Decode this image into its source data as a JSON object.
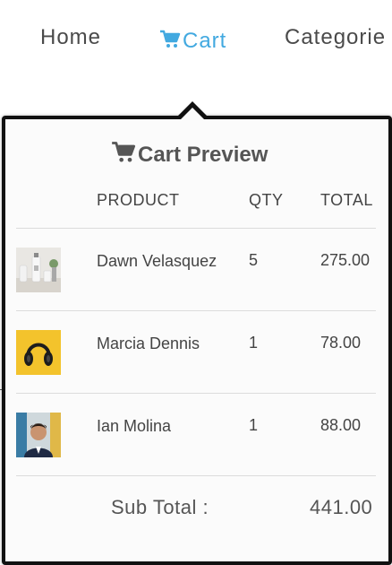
{
  "nav": {
    "home_label": "Home",
    "cart_label": "Cart",
    "categories_label": "Categorie",
    "accent_color": "#42a9e0"
  },
  "popup": {
    "title": "Cart Preview",
    "title_icon": "cart-icon",
    "columns": {
      "product": "PRODUCT",
      "qty": "QTY",
      "total": "TOTAL"
    },
    "items": [
      {
        "name": "Dawn Velasquez",
        "qty": "5",
        "total": "275.00",
        "thumbnail": "bottles-product-thumbnail"
      },
      {
        "name": "Marcia Dennis",
        "qty": "1",
        "total": "78.00",
        "thumbnail": "headphones-product-thumbnail"
      },
      {
        "name": "Ian Molina",
        "qty": "1",
        "total": "88.00",
        "thumbnail": "man-portrait-product-thumbnail"
      }
    ],
    "subtotal_label": "Sub Total :",
    "subtotal_value": "441.00"
  }
}
